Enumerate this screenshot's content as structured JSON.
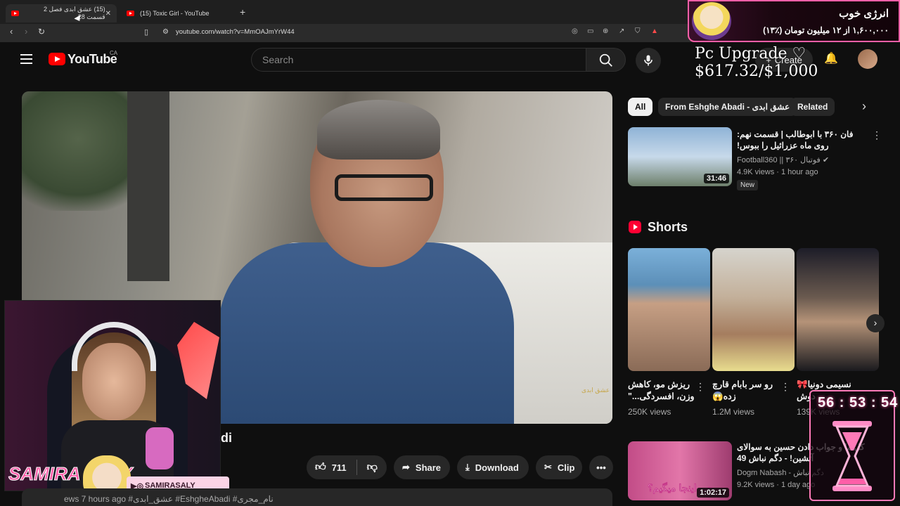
{
  "browser": {
    "tabs": [
      {
        "title": "(15) عشق ابدی فصل 2 قسمت 28",
        "active": true
      },
      {
        "title": "(15) Toxic Girl - YouTube",
        "active": false
      }
    ],
    "new_tab": "+",
    "url": "youtube.com/watch?v=MmOAJmYrW44"
  },
  "youtube": {
    "logo": "YouTube",
    "country": "CA",
    "search_placeholder": "Search",
    "create_label": "Create"
  },
  "overlay": {
    "energy_title": "انرژی خوب",
    "energy_sub": "۱,۶۰۰,۰۰۰ از ۱۲ میلیون تومان (٪۱۳)",
    "pc_goal": "Pc Upgrade ♡ $617.32/$1,000",
    "timer": "56 : 53 : 54",
    "streamer_name": "SAMIRA SALY",
    "social_handle": "SAMIRASALY"
  },
  "video": {
    "title_fragment": "di",
    "watermark": "عشق ابدی",
    "likes": "711",
    "share_label": "Share",
    "download_label": "Download",
    "clip_label": "Clip",
    "description_preview": "ews   7 hours ago   #عشق_ابدی   #EshgheAbadi   #نام_مجری"
  },
  "sidebar": {
    "chips": [
      "All",
      "From Eshghe Abadi - عشق ابدی",
      "Related"
    ],
    "rec1": {
      "title": "فان ۳۶۰ با ابوطالب | قسمت نهم: روی ماه عزرائیل را ببوس!",
      "channel": "Football360 || فوتبال ۳۶۰",
      "meta": "4.9K views · 1 hour ago",
      "badge": "New",
      "duration": "31:46"
    },
    "shorts_title": "Shorts",
    "shorts": [
      {
        "title": "ریزش مو، کاهش وزن، افسردگی...\"",
        "views": "250K views"
      },
      {
        "title": "رو سر بابام قارچ زده😱",
        "views": "1.2M views"
      },
      {
        "title": "نسیمی دونیا🎀 دوش",
        "views": "139K views"
      }
    ],
    "rec2": {
      "title": "کل ما و جواب دادن حسین به سوالای آتشین! - دگم نباش 49",
      "channel": "Dogm Nabash - دگم نباش",
      "meta": "9.2K views · 1 day ago",
      "caption": "چی اینجا میگیم؟",
      "duration": "1:02:17"
    }
  },
  "colors": {
    "bg": "#0f0f0f",
    "accent": "#ff0000",
    "overlay_pink": "#ff5fa8"
  }
}
